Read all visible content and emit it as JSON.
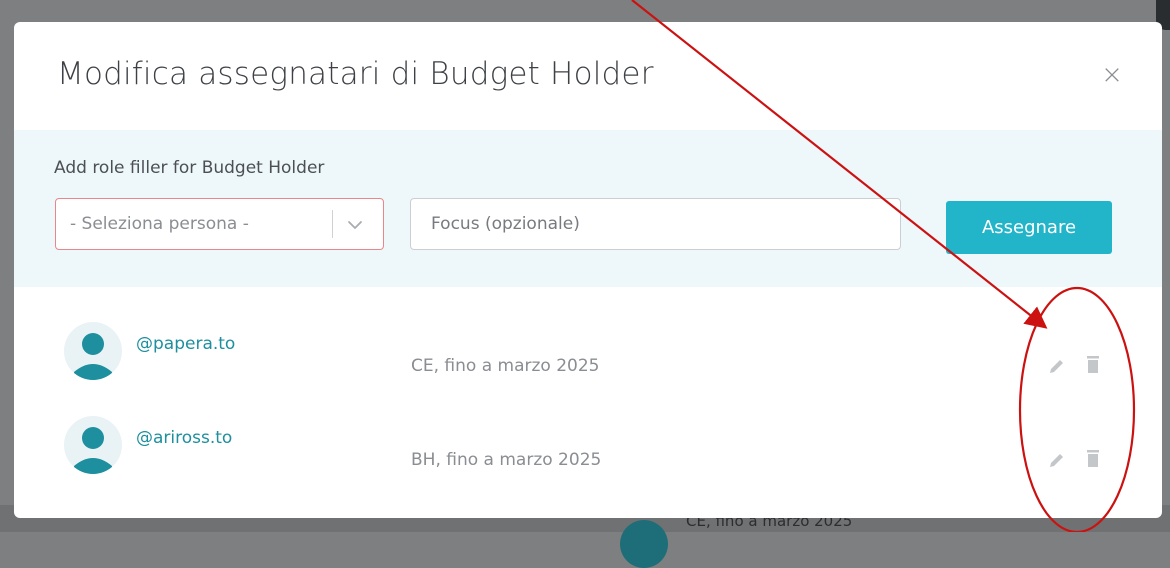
{
  "modal": {
    "title": "Modifica assegnatari di Budget Holder",
    "close_label": "×"
  },
  "assign_form": {
    "label": "Add role filler for Budget Holder",
    "person_select_placeholder": "- Seleziona persona -",
    "focus_placeholder": "Focus (opzionale)",
    "focus_value": "",
    "submit_label": "Assegnare"
  },
  "assignees": [
    {
      "handle": "@papera.to",
      "focus": "CE, fino a marzo 2025"
    },
    {
      "handle": "@ariross.to",
      "focus": "BH, fino a marzo 2025"
    }
  ],
  "background": {
    "partial_text": "CE, fino a marzo 2025"
  },
  "icons": {
    "close": "close-icon",
    "chevron": "chevron-down-icon",
    "avatar": "user-avatar-icon",
    "edit": "pencil-icon",
    "delete": "trash-icon"
  },
  "colors": {
    "accent": "#22b4c8",
    "link": "#1d8f9e",
    "error_border": "#e8868a",
    "panel_bg": "#eef7fa",
    "annotation": "#cc1111"
  }
}
